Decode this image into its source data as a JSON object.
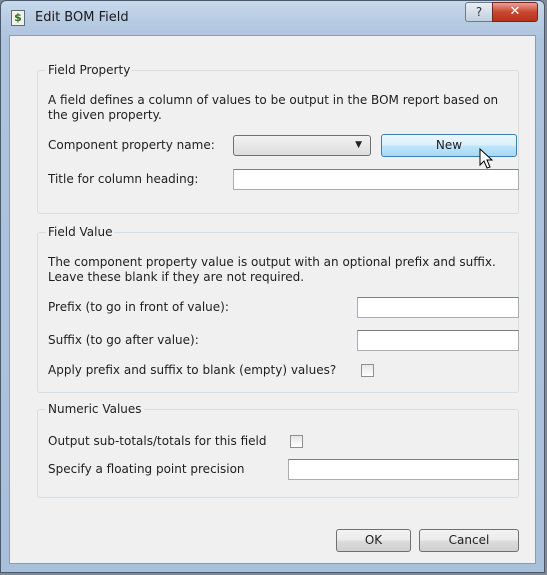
{
  "window": {
    "title": "Edit BOM Field",
    "app_icon": "dollar-document-icon",
    "help_label": "?",
    "close_label": "✕"
  },
  "field_property": {
    "legend": "Field Property",
    "description_line1": "A field defines a column of values to be output in the BOM report based on",
    "description_line2": "the given property.",
    "component_property_label": "Component property name:",
    "component_property_value": "",
    "new_button_label": "New",
    "title_heading_label": "Title for column heading:",
    "title_heading_value": ""
  },
  "field_value": {
    "legend": "Field Value",
    "description_line1": "The component property value is output with an optional prefix and suffix.",
    "description_line2": "Leave these blank if they are not required.",
    "prefix_label": "Prefix (to go in front of value):",
    "prefix_value": "",
    "suffix_label": "Suffix (to go after value):",
    "suffix_value": "",
    "apply_blank_label": "Apply prefix and suffix to blank (empty) values?",
    "apply_blank_checked": false
  },
  "numeric_values": {
    "legend": "Numeric Values",
    "subtotals_label": "Output sub-totals/totals for this field",
    "subtotals_checked": false,
    "precision_label": "Specify a floating point precision",
    "precision_value": ""
  },
  "footer": {
    "ok_label": "OK",
    "cancel_label": "Cancel"
  }
}
